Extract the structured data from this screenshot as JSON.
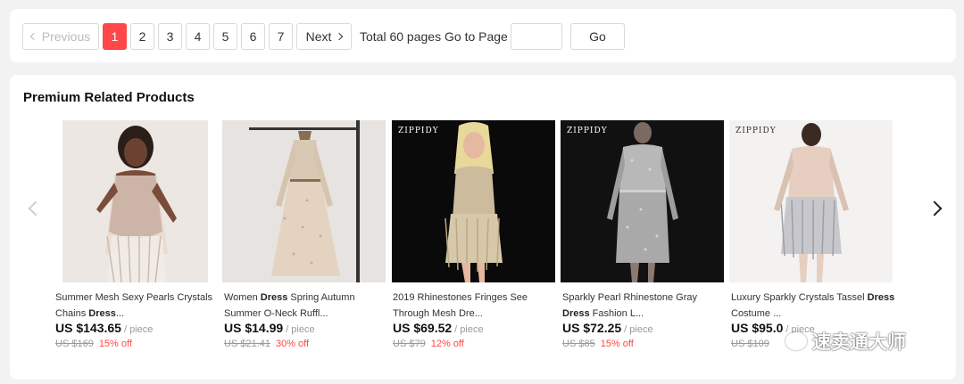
{
  "pagination": {
    "previous_label": "Previous",
    "pages": [
      "1",
      "2",
      "3",
      "4",
      "5",
      "6",
      "7"
    ],
    "current_page": "1",
    "next_label": "Next",
    "total_label": "Total 60 pages",
    "goto_label": "Go to Page",
    "goto_input_value": "",
    "go_button_label": "Go",
    "active_color": "#ff4747"
  },
  "related": {
    "title": "Premium Related Products",
    "products": [
      {
        "title_pre": "Summer Mesh Sexy Pearls Crystals Chains ",
        "title_bold": "Dress",
        "title_post": "...",
        "price": "US $143.65",
        "unit": "/ piece",
        "old_price": "US $169",
        "discount": "15% off",
        "brand_mark": ""
      },
      {
        "title_pre": "Women ",
        "title_bold": "Dress",
        "title_post": " Spring Autumn Summer O-Neck Ruffl...",
        "price": "US $14.99",
        "unit": "/ piece",
        "old_price": "US $21.41",
        "discount": "30% off",
        "brand_mark": ""
      },
      {
        "title_pre": "2019 Rhinestones Fringes See Through Mesh Dre...",
        "title_bold": "",
        "title_post": "",
        "price": "US $69.52",
        "unit": "/ piece",
        "old_price": "US $79",
        "discount": "12% off",
        "brand_mark": "ZIPPIDY"
      },
      {
        "title_pre": "Sparkly Pearl Rhinestone Gray ",
        "title_bold": "Dress",
        "title_post": " Fashion L...",
        "price": "US $72.25",
        "unit": "/ piece",
        "old_price": "US $85",
        "discount": "15% off",
        "brand_mark": "ZIPPIDY"
      },
      {
        "title_pre": "Luxury Sparkly Crystals Tassel ",
        "title_bold": "Dress",
        "title_post": " Costume ...",
        "price": "US $95.0",
        "unit": "/ piece",
        "old_price": "US $109",
        "discount": "",
        "brand_mark": "ZIPPIDY"
      }
    ]
  },
  "watermark": {
    "text": "速卖通大师",
    "icon": "wechat-icon"
  }
}
